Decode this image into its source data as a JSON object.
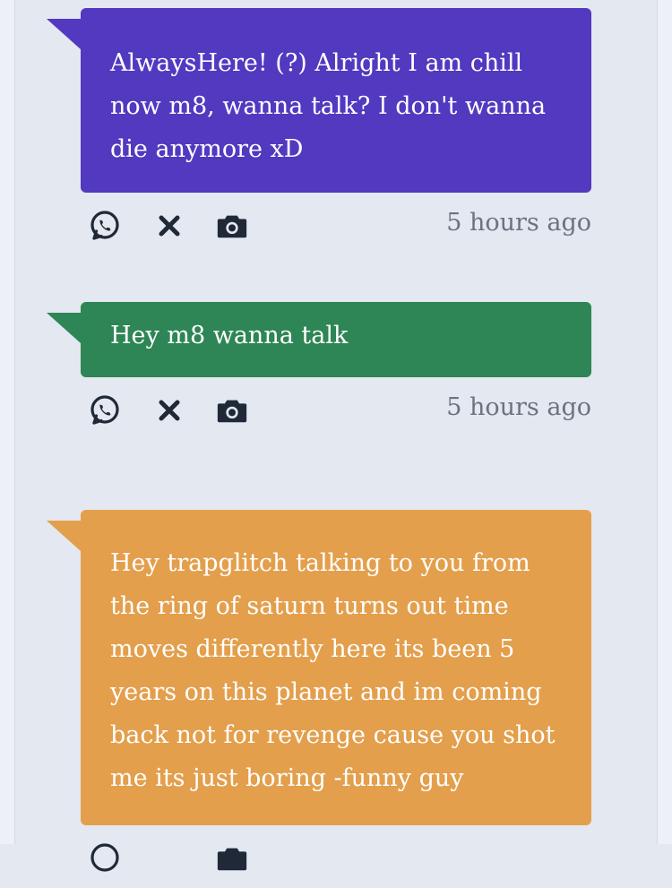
{
  "feed": {
    "messages": [
      {
        "color": "#5239c0",
        "lines": [
          "AlwaysHere! (?) Alright I am chill",
          "now m8, wanna talk? I don't wanna",
          "die anymore xD"
        ],
        "time": "5 hours ago"
      },
      {
        "color": "#2e8555",
        "lines": [
          "Hey m8 wanna talk"
        ],
        "time": "5 hours ago"
      },
      {
        "color": "#e39f4c",
        "lines": [
          "Hey trapglitch talking to you from",
          "the ring of saturn turns out time",
          "moves differently here its been 5",
          "years on this planet and im coming",
          "back not for revenge cause you shot",
          "me its just boring -funny guy"
        ],
        "time": ""
      }
    ],
    "actions": {
      "share_icon": "whatsapp-icon",
      "delete_icon": "close-icon",
      "screenshot_icon": "camera-icon"
    }
  }
}
